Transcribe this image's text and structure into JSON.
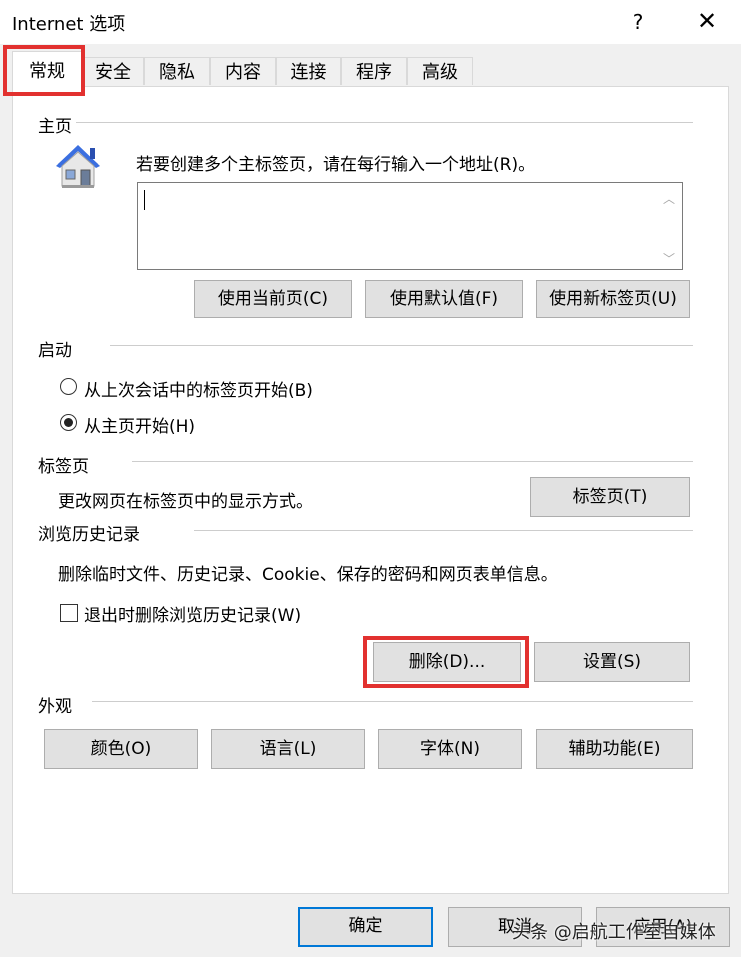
{
  "window": {
    "title": "Internet 选项",
    "help": "?",
    "close": "✕"
  },
  "tabs": [
    "常规",
    "安全",
    "隐私",
    "内容",
    "连接",
    "程序",
    "高级"
  ],
  "homepage": {
    "section": "主页",
    "instruction": "若要创建多个主标签页，请在每行输入一个地址(R)。",
    "value": "",
    "buttons": [
      "使用当前页(C)",
      "使用默认值(F)",
      "使用新标签页(U)"
    ]
  },
  "startup": {
    "section": "启动",
    "options": [
      {
        "label": "从上次会话中的标签页开始(B)",
        "selected": false
      },
      {
        "label": "从主页开始(H)",
        "selected": true
      }
    ]
  },
  "tabs_section": {
    "section": "标签页",
    "description": "更改网页在标签页中的显示方式。",
    "button": "标签页(T)"
  },
  "history": {
    "section": "浏览历史记录",
    "description": "删除临时文件、历史记录、Cookie、保存的密码和网页表单信息。",
    "checkbox_label": "退出时删除浏览历史记录(W)",
    "checked": false,
    "delete_button": "删除(D)...",
    "settings_button": "设置(S)"
  },
  "appearance": {
    "section": "外观",
    "buttons": [
      "颜色(O)",
      "语言(L)",
      "字体(N)",
      "辅助功能(E)"
    ]
  },
  "footer": {
    "ok": "确定",
    "cancel": "取消",
    "apply": "应用(A)"
  },
  "watermark": "头条 @启航工作室自媒体",
  "colors": {
    "highlight": "#e2312f",
    "focus": "#0078d7",
    "house_roof": "#2f5fd0"
  }
}
